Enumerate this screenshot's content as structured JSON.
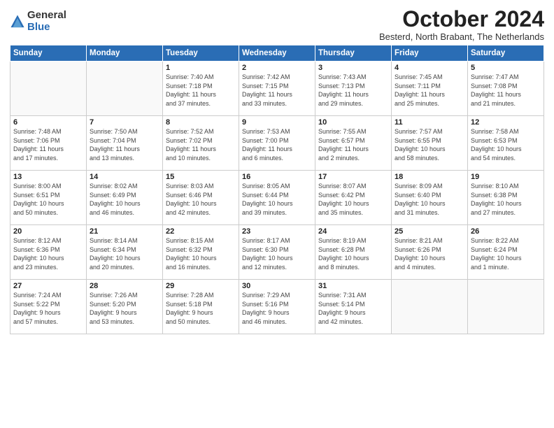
{
  "logo": {
    "general": "General",
    "blue": "Blue"
  },
  "header": {
    "title": "October 2024",
    "subtitle": "Besterd, North Brabant, The Netherlands"
  },
  "days_of_week": [
    "Sunday",
    "Monday",
    "Tuesday",
    "Wednesday",
    "Thursday",
    "Friday",
    "Saturday"
  ],
  "weeks": [
    [
      {
        "day": "",
        "info": ""
      },
      {
        "day": "",
        "info": ""
      },
      {
        "day": "1",
        "info": "Sunrise: 7:40 AM\nSunset: 7:18 PM\nDaylight: 11 hours\nand 37 minutes."
      },
      {
        "day": "2",
        "info": "Sunrise: 7:42 AM\nSunset: 7:15 PM\nDaylight: 11 hours\nand 33 minutes."
      },
      {
        "day": "3",
        "info": "Sunrise: 7:43 AM\nSunset: 7:13 PM\nDaylight: 11 hours\nand 29 minutes."
      },
      {
        "day": "4",
        "info": "Sunrise: 7:45 AM\nSunset: 7:11 PM\nDaylight: 11 hours\nand 25 minutes."
      },
      {
        "day": "5",
        "info": "Sunrise: 7:47 AM\nSunset: 7:08 PM\nDaylight: 11 hours\nand 21 minutes."
      }
    ],
    [
      {
        "day": "6",
        "info": "Sunrise: 7:48 AM\nSunset: 7:06 PM\nDaylight: 11 hours\nand 17 minutes."
      },
      {
        "day": "7",
        "info": "Sunrise: 7:50 AM\nSunset: 7:04 PM\nDaylight: 11 hours\nand 13 minutes."
      },
      {
        "day": "8",
        "info": "Sunrise: 7:52 AM\nSunset: 7:02 PM\nDaylight: 11 hours\nand 10 minutes."
      },
      {
        "day": "9",
        "info": "Sunrise: 7:53 AM\nSunset: 7:00 PM\nDaylight: 11 hours\nand 6 minutes."
      },
      {
        "day": "10",
        "info": "Sunrise: 7:55 AM\nSunset: 6:57 PM\nDaylight: 11 hours\nand 2 minutes."
      },
      {
        "day": "11",
        "info": "Sunrise: 7:57 AM\nSunset: 6:55 PM\nDaylight: 10 hours\nand 58 minutes."
      },
      {
        "day": "12",
        "info": "Sunrise: 7:58 AM\nSunset: 6:53 PM\nDaylight: 10 hours\nand 54 minutes."
      }
    ],
    [
      {
        "day": "13",
        "info": "Sunrise: 8:00 AM\nSunset: 6:51 PM\nDaylight: 10 hours\nand 50 minutes."
      },
      {
        "day": "14",
        "info": "Sunrise: 8:02 AM\nSunset: 6:49 PM\nDaylight: 10 hours\nand 46 minutes."
      },
      {
        "day": "15",
        "info": "Sunrise: 8:03 AM\nSunset: 6:46 PM\nDaylight: 10 hours\nand 42 minutes."
      },
      {
        "day": "16",
        "info": "Sunrise: 8:05 AM\nSunset: 6:44 PM\nDaylight: 10 hours\nand 39 minutes."
      },
      {
        "day": "17",
        "info": "Sunrise: 8:07 AM\nSunset: 6:42 PM\nDaylight: 10 hours\nand 35 minutes."
      },
      {
        "day": "18",
        "info": "Sunrise: 8:09 AM\nSunset: 6:40 PM\nDaylight: 10 hours\nand 31 minutes."
      },
      {
        "day": "19",
        "info": "Sunrise: 8:10 AM\nSunset: 6:38 PM\nDaylight: 10 hours\nand 27 minutes."
      }
    ],
    [
      {
        "day": "20",
        "info": "Sunrise: 8:12 AM\nSunset: 6:36 PM\nDaylight: 10 hours\nand 23 minutes."
      },
      {
        "day": "21",
        "info": "Sunrise: 8:14 AM\nSunset: 6:34 PM\nDaylight: 10 hours\nand 20 minutes."
      },
      {
        "day": "22",
        "info": "Sunrise: 8:15 AM\nSunset: 6:32 PM\nDaylight: 10 hours\nand 16 minutes."
      },
      {
        "day": "23",
        "info": "Sunrise: 8:17 AM\nSunset: 6:30 PM\nDaylight: 10 hours\nand 12 minutes."
      },
      {
        "day": "24",
        "info": "Sunrise: 8:19 AM\nSunset: 6:28 PM\nDaylight: 10 hours\nand 8 minutes."
      },
      {
        "day": "25",
        "info": "Sunrise: 8:21 AM\nSunset: 6:26 PM\nDaylight: 10 hours\nand 4 minutes."
      },
      {
        "day": "26",
        "info": "Sunrise: 8:22 AM\nSunset: 6:24 PM\nDaylight: 10 hours\nand 1 minute."
      }
    ],
    [
      {
        "day": "27",
        "info": "Sunrise: 7:24 AM\nSunset: 5:22 PM\nDaylight: 9 hours\nand 57 minutes."
      },
      {
        "day": "28",
        "info": "Sunrise: 7:26 AM\nSunset: 5:20 PM\nDaylight: 9 hours\nand 53 minutes."
      },
      {
        "day": "29",
        "info": "Sunrise: 7:28 AM\nSunset: 5:18 PM\nDaylight: 9 hours\nand 50 minutes."
      },
      {
        "day": "30",
        "info": "Sunrise: 7:29 AM\nSunset: 5:16 PM\nDaylight: 9 hours\nand 46 minutes."
      },
      {
        "day": "31",
        "info": "Sunrise: 7:31 AM\nSunset: 5:14 PM\nDaylight: 9 hours\nand 42 minutes."
      },
      {
        "day": "",
        "info": ""
      },
      {
        "day": "",
        "info": ""
      }
    ]
  ]
}
